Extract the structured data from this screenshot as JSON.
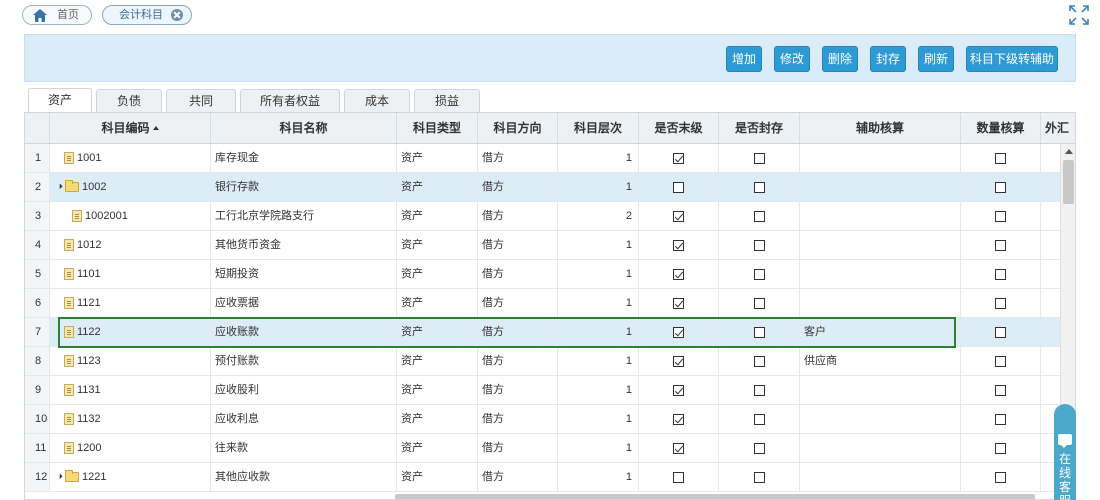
{
  "nav_tabs": [
    {
      "label": "首页"
    },
    {
      "label": "会计科目"
    }
  ],
  "toolbar": {
    "buttons": [
      {
        "label": "增加"
      },
      {
        "label": "修改"
      },
      {
        "label": "删除"
      },
      {
        "label": "封存"
      },
      {
        "label": "刷新"
      },
      {
        "label": "科目下级转辅助"
      }
    ]
  },
  "sub_tabs": [
    {
      "label": "资产",
      "active": true
    },
    {
      "label": "负债"
    },
    {
      "label": "共同"
    },
    {
      "label": "所有者权益"
    },
    {
      "label": "成本"
    },
    {
      "label": "损益"
    }
  ],
  "grid": {
    "columns": [
      "",
      "科目编码",
      "科目名称",
      "科目类型",
      "科目方向",
      "科目层次",
      "是否末级",
      "是否封存",
      "辅助核算",
      "数量核算",
      "外汇"
    ],
    "sorted_column": "科目编码",
    "selected_row": 2,
    "focused_row": 7,
    "rows": [
      {
        "rn": "1",
        "code": "1001",
        "icon": "file",
        "expand": false,
        "indent": 1,
        "name": "库存现金",
        "type": "资产",
        "direction": "借方",
        "level": "1",
        "leaf": true,
        "sealed": false,
        "aux": "",
        "qty": false
      },
      {
        "rn": "2",
        "code": "1002",
        "icon": "folder",
        "expand": true,
        "indent": 0,
        "name": "银行存款",
        "type": "资产",
        "direction": "借方",
        "level": "1",
        "leaf": false,
        "sealed": false,
        "aux": "",
        "qty": false
      },
      {
        "rn": "3",
        "code": "1002001",
        "icon": "file",
        "expand": false,
        "indent": 2,
        "name": "工行北京学院路支行",
        "type": "资产",
        "direction": "借方",
        "level": "2",
        "leaf": true,
        "sealed": false,
        "aux": "",
        "qty": false
      },
      {
        "rn": "4",
        "code": "1012",
        "icon": "file",
        "expand": false,
        "indent": 1,
        "name": "其他货币资金",
        "type": "资产",
        "direction": "借方",
        "level": "1",
        "leaf": true,
        "sealed": false,
        "aux": "",
        "qty": false
      },
      {
        "rn": "5",
        "code": "1101",
        "icon": "file",
        "expand": false,
        "indent": 1,
        "name": "短期投资",
        "type": "资产",
        "direction": "借方",
        "level": "1",
        "leaf": true,
        "sealed": false,
        "aux": "",
        "qty": false
      },
      {
        "rn": "6",
        "code": "1121",
        "icon": "file",
        "expand": false,
        "indent": 1,
        "name": "应收票据",
        "type": "资产",
        "direction": "借方",
        "level": "1",
        "leaf": true,
        "sealed": false,
        "aux": "",
        "qty": false
      },
      {
        "rn": "7",
        "code": "1122",
        "icon": "file",
        "expand": false,
        "indent": 1,
        "name": "应收账款",
        "type": "资产",
        "direction": "借方",
        "level": "1",
        "leaf": true,
        "sealed": false,
        "aux": "客户",
        "qty": false
      },
      {
        "rn": "8",
        "code": "1123",
        "icon": "file",
        "expand": false,
        "indent": 1,
        "name": "预付账款",
        "type": "资产",
        "direction": "借方",
        "level": "1",
        "leaf": true,
        "sealed": false,
        "aux": "供应商",
        "qty": false
      },
      {
        "rn": "9",
        "code": "1131",
        "icon": "file",
        "expand": false,
        "indent": 1,
        "name": "应收股利",
        "type": "资产",
        "direction": "借方",
        "level": "1",
        "leaf": true,
        "sealed": false,
        "aux": "",
        "qty": false
      },
      {
        "rn": "10",
        "code": "1132",
        "icon": "file",
        "expand": false,
        "indent": 1,
        "name": "应收利息",
        "type": "资产",
        "direction": "借方",
        "level": "1",
        "leaf": true,
        "sealed": false,
        "aux": "",
        "qty": false
      },
      {
        "rn": "11",
        "code": "1200",
        "icon": "file",
        "expand": false,
        "indent": 1,
        "name": "往来款",
        "type": "资产",
        "direction": "借方",
        "level": "1",
        "leaf": true,
        "sealed": false,
        "aux": "",
        "qty": false
      },
      {
        "rn": "12",
        "code": "1221",
        "icon": "folder",
        "expand": true,
        "indent": 0,
        "name": "其他应收款",
        "type": "资产",
        "direction": "借方",
        "level": "1",
        "leaf": false,
        "sealed": false,
        "aux": "",
        "qty": false
      }
    ]
  },
  "chat_widget": {
    "label": "在线客服"
  },
  "colors": {
    "accent": "#2e9ad4",
    "toolbar_bg": "#d9ecf7",
    "selected_row": "#dcedf8",
    "focus_border": "#2e7d32"
  }
}
